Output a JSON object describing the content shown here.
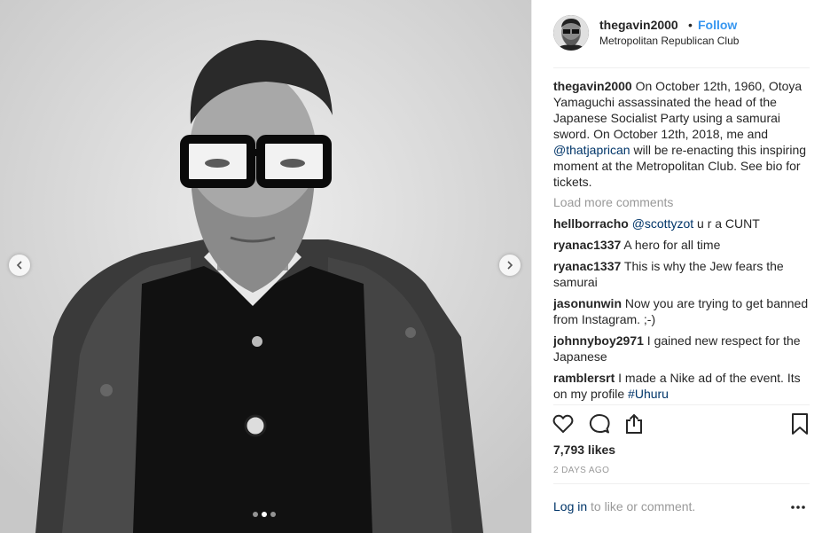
{
  "post": {
    "media_alt": "photo",
    "carousel": {
      "count": 3,
      "active_index": 1
    }
  },
  "header": {
    "username": "thegavin2000",
    "separator": "•",
    "follow_label": "Follow",
    "location": "Metropolitan Republican Club"
  },
  "caption": {
    "username": "thegavin2000",
    "text_1": " On October 12th, 1960, Otoya Yamaguchi assassinated the head of the Japanese Socialist Party using a samurai sword. On October 12th, 2018, me and ",
    "mention": "@thatjaprican",
    "text_2": " will be re-enacting this inspiring moment at the Metropolitan Club. See bio for tickets."
  },
  "load_more_label": "Load more comments",
  "comments": [
    {
      "username": "hellborracho",
      "mention": "@scottyzot",
      "text": " u r a CUNT"
    },
    {
      "username": "ryanac1337",
      "mention": "",
      "text": " A hero for all time"
    },
    {
      "username": "ryanac1337",
      "mention": "",
      "text": " This is why the Jew fears the samurai"
    },
    {
      "username": "jasonunwin",
      "mention": "",
      "text": " Now you are trying to get banned from Instagram. ;-)"
    },
    {
      "username": "johnnyboy2971",
      "mention": "",
      "text": " I gained new respect for the Japanese"
    },
    {
      "username": "ramblersrt",
      "text": " I made a Nike ad of the event. Its on my profile ",
      "hashtag": "#Uhuru"
    }
  ],
  "actions": {
    "like_icon": "heart-icon",
    "comment_icon": "speech-bubble-icon",
    "share_icon": "share-icon",
    "save_icon": "bookmark-icon"
  },
  "likes_label": "7,793 likes",
  "timestamp": "2 DAYS AGO",
  "footer": {
    "login_link": "Log in",
    "login_text": " to like or comment.",
    "more_icon": "ellipsis-icon"
  },
  "colors": {
    "link_blue": "#3897f0",
    "mention_blue": "#003569",
    "muted": "#999999",
    "text": "#262626"
  }
}
